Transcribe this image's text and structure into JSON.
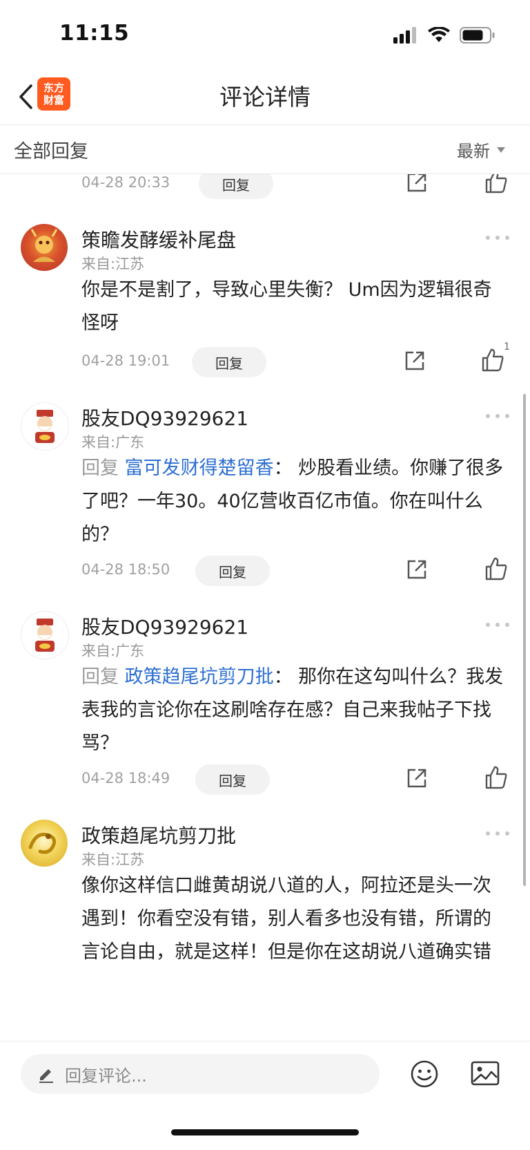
{
  "status_bar": {
    "time": "11:15"
  },
  "nav": {
    "title": "评论详情",
    "logo_line1": "东方",
    "logo_line2": "财富"
  },
  "filter": {
    "left_label": "全部回复",
    "sort_label": "最新"
  },
  "top_partial": {
    "date": "04-28 20:33",
    "reply_label": "回复"
  },
  "comments": [
    {
      "username": "策瞻发酵缓补尾盘",
      "location": "来自:江苏",
      "text": "你是不是割了，导致心里失衡？ Um因为逻辑很奇怪呀",
      "date": "04-28 19:01",
      "reply_label": "回复",
      "likes": "1"
    },
    {
      "username": "股友DQ93929621",
      "location": "来自:广东",
      "reply_prefix": "回复",
      "mention": "富可发财得楚留香",
      "text": "： 炒股看业绩。你赚了很多了吧？一年30。40亿营收百亿市值。你在叫什么的？",
      "date": "04-28 18:50",
      "reply_label": "回复"
    },
    {
      "username": "股友DQ93929621",
      "location": "来自:广东",
      "reply_prefix": "回复",
      "mention": "政策趋尾坑剪刀批",
      "text": "： 那你在这勾叫什么？我发表我的言论你在这刷啥存在感？自己来我帖子下找骂？",
      "date": "04-28 18:49",
      "reply_label": "回复"
    },
    {
      "username": "政策趋尾坑剪刀批",
      "location": "来自:江苏",
      "text": "像你这样信口雌黄胡说八道的人，阿拉还是头一次遇到！你看空没有错，别人看多也没有错，所谓的言论自由，就是这样！但是你在这胡说八道确实错"
    }
  ],
  "bottom_bar": {
    "input_placeholder": "回复评论..."
  },
  "colors": {
    "mention": "#2d6fd1",
    "logo": "#ff5a1f",
    "secondary_text": "#999999"
  }
}
